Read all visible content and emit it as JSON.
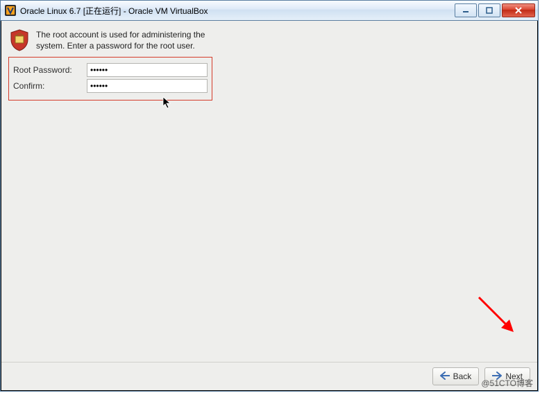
{
  "window": {
    "title": "Oracle Linux 6.7 [正在运行] - Oracle VM VirtualBox"
  },
  "installer": {
    "intro": "The root account is used for administering the system.  Enter a password for the root user.",
    "root_password_label": "Root Password:",
    "confirm_label": "Confirm:",
    "root_password_value": "••••••",
    "confirm_value": "••••••"
  },
  "footer": {
    "back_label": "Back",
    "next_label": "Next"
  },
  "watermark": "@51CTO博客"
}
